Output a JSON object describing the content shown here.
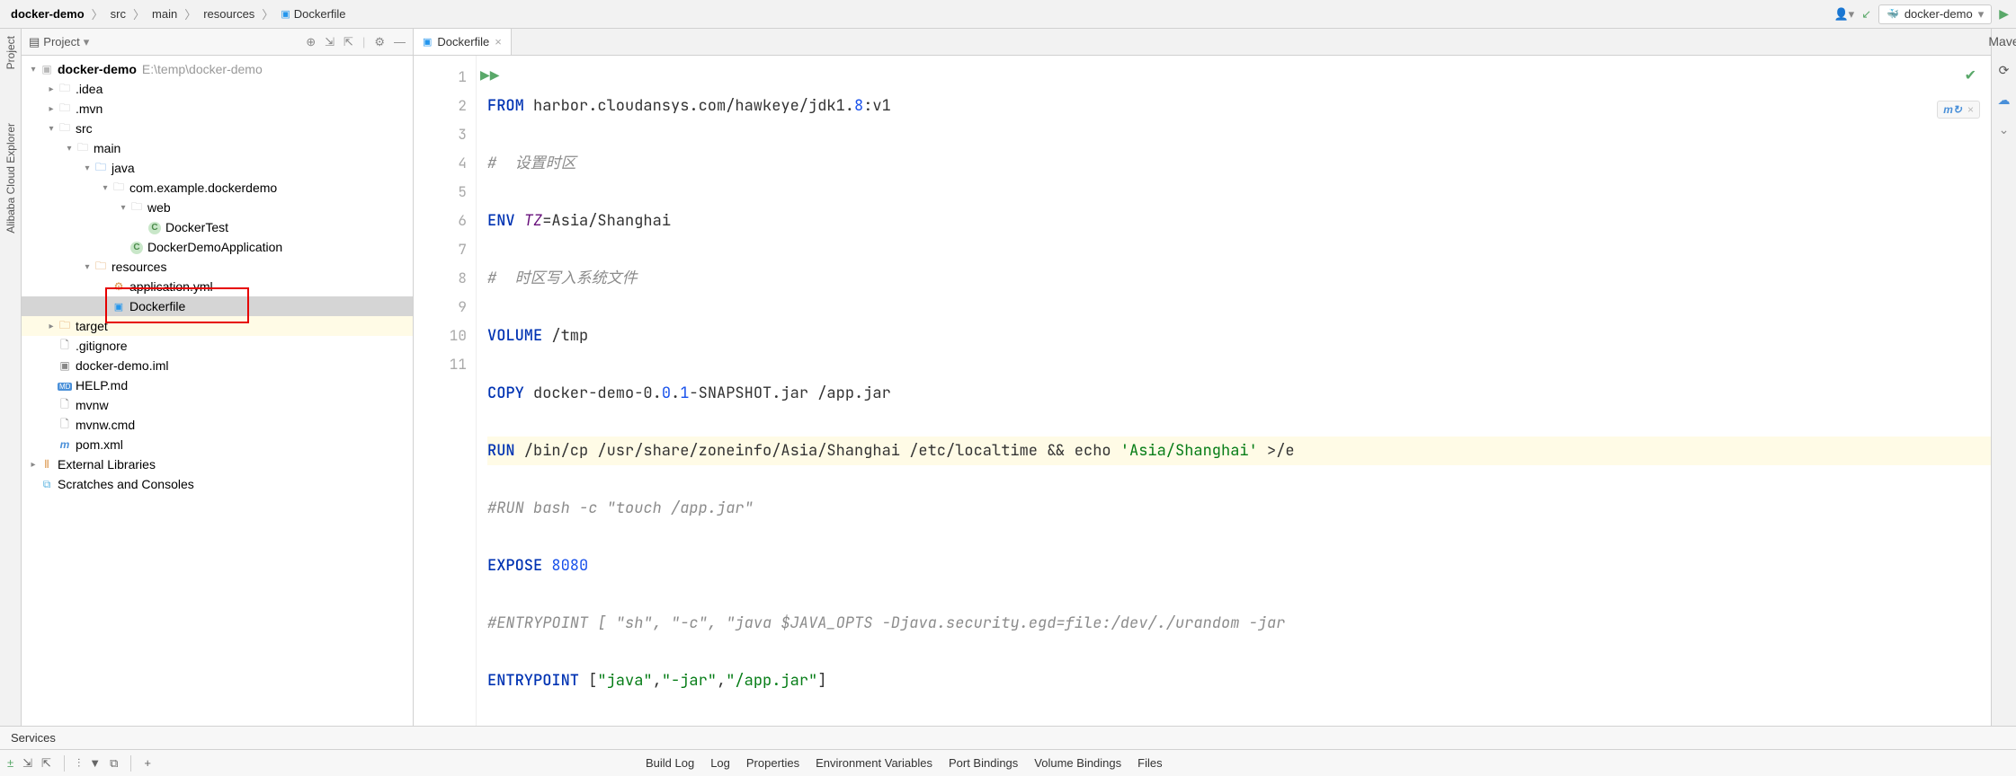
{
  "breadcrumb": {
    "items": [
      "docker-demo",
      "src",
      "main",
      "resources",
      "Dockerfile"
    ]
  },
  "run_config": {
    "label": "docker-demo"
  },
  "project_panel": {
    "title": "Project"
  },
  "tree": {
    "root_name": "docker-demo",
    "root_path": "E:\\temp\\docker-demo",
    "nodes": {
      "idea": ".idea",
      "mvn": ".mvn",
      "src": "src",
      "main": "main",
      "java": "java",
      "pkg": "com.example.dockerdemo",
      "web": "web",
      "dockertest": "DockerTest",
      "app": "DockerDemoApplication",
      "resources": "resources",
      "appyml": "application.yml",
      "dockerfile": "Dockerfile",
      "target": "target",
      "gitignore": ".gitignore",
      "iml": "docker-demo.iml",
      "help": "HELP.md",
      "mvnw": "mvnw",
      "mvnwcmd": "mvnw.cmd",
      "pom": "pom.xml",
      "extlib": "External Libraries",
      "scratch": "Scratches and Consoles"
    }
  },
  "editor": {
    "tab_name": "Dockerfile",
    "lines": {
      "l1": {
        "kw": "FROM",
        "rest": " harbor.cloudansys.com/hawkeye/jdk1.",
        "num": "8",
        "rest2": ":v1"
      },
      "l2": "#  设置时区",
      "l3": {
        "kw": "ENV",
        "id": " TZ",
        "rest": "=Asia/Shanghai"
      },
      "l4": "#  时区写入系统文件",
      "l5": {
        "kw": "VOLUME",
        "rest": " /tmp"
      },
      "l6": {
        "kw": "COPY",
        "rest": " docker-demo-0.",
        "num1": "0",
        "dot": ".",
        "num2": "1",
        "rest2": "-SNAPSHOT.jar /app.jar"
      },
      "l7": {
        "kw": "RUN",
        "rest": " /bin/cp /usr/share/zoneinfo/Asia/Shanghai /etc/localtime && echo ",
        "str": "'Asia/Shanghai'",
        "rest2": " >/e"
      },
      "l8": "#RUN bash -c \"touch /app.jar\"",
      "l9": {
        "kw": "EXPOSE",
        "sp": " ",
        "num": "8080"
      },
      "l10": "#ENTRYPOINT [ \"sh\", \"-c\", \"java $JAVA_OPTS -Djava.security.egd=file:/dev/./urandom -jar",
      "l11": {
        "kw": "ENTRYPOINT",
        "rest": " [",
        "s1": "\"java\"",
        "c1": ",",
        "s2": "\"-jar\"",
        "c2": ",",
        "s3": "\"/app.jar\"",
        "rest2": "]"
      }
    },
    "line_numbers": [
      "1",
      "2",
      "3",
      "4",
      "5",
      "6",
      "7",
      "8",
      "9",
      "10",
      "11"
    ]
  },
  "vtabs_left": {
    "project": "Project",
    "alibaba": "Alibaba Cloud Explorer"
  },
  "vtabs_right": {
    "maven": "Mave"
  },
  "services": {
    "label": "Services"
  },
  "bottom_tabs": {
    "build_log": "Build Log",
    "log": "Log",
    "properties": "Properties",
    "env": "Environment Variables",
    "port": "Port Bindings",
    "vol": "Volume Bindings",
    "files": "Files"
  }
}
